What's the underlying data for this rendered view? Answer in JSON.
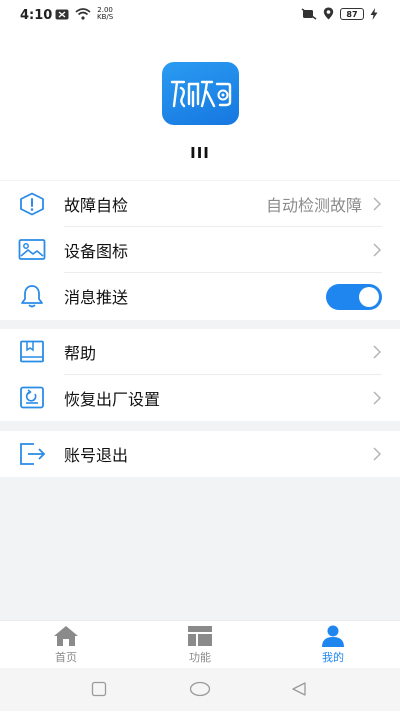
{
  "status_bar": {
    "time": "4:10",
    "net_speed_value": "2.00",
    "net_speed_unit": "KB/S",
    "battery_level": "87"
  },
  "profile": {
    "device_name": "III"
  },
  "settings_group_1": [
    {
      "label": "故障自检",
      "value": "自动检测故障",
      "icon": "shield-alert-icon"
    },
    {
      "label": "设备图标",
      "value": "",
      "icon": "image-icon"
    },
    {
      "label": "消息推送",
      "value": "",
      "icon": "bell-icon",
      "toggle_on": true
    }
  ],
  "settings_group_2": [
    {
      "label": "帮助",
      "icon": "book-icon"
    },
    {
      "label": "恢复出厂设置",
      "icon": "restore-icon"
    }
  ],
  "settings_group_3": [
    {
      "label": "账号退出",
      "icon": "logout-icon"
    }
  ],
  "tab_bar": {
    "tabs": [
      {
        "label": "首页",
        "icon": "home-icon",
        "active": false
      },
      {
        "label": "功能",
        "icon": "grid-icon",
        "active": false
      },
      {
        "label": "我的",
        "icon": "user-icon",
        "active": true
      }
    ]
  },
  "colors": {
    "accent": "#1f86f0",
    "background": "#f2f3f5",
    "inactive": "#8a8a8a"
  }
}
